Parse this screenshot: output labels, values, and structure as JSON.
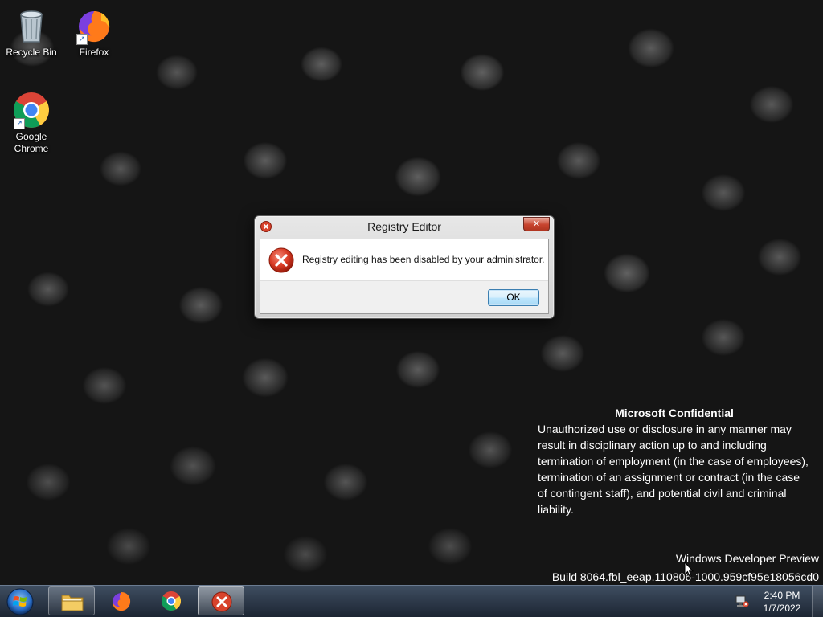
{
  "desktop": {
    "icons": [
      {
        "label": "Recycle Bin",
        "icon": "recycle-bin-icon"
      },
      {
        "label": "Firefox",
        "icon": "firefox-icon"
      },
      {
        "label": "Google Chrome",
        "icon": "chrome-icon"
      }
    ],
    "confidential": {
      "heading": "Microsoft Confidential",
      "body": "Unauthorized use or disclosure in any manner may result in disciplinary action up to and including termination of employment (in the case of employees), termination of an assignment or contract (in the case of contingent staff), and potential civil and criminal liability."
    },
    "watermark": {
      "line1": "Windows Developer Preview",
      "line2": "Build 8064.fbl_eeap.110806-1000.959cf95e18056cd0"
    }
  },
  "dialog": {
    "title": "Registry Editor",
    "message": "Registry editing has been disabled by your administrator.",
    "ok_label": "OK",
    "close_glyph": "✕",
    "icon": "error-icon"
  },
  "taskbar": {
    "start": "start-button",
    "pinned": [
      "file-explorer",
      "firefox",
      "chrome",
      "error-dialog-window"
    ],
    "clock": {
      "time": "2:40 PM",
      "date": "1/7/2022"
    },
    "accent": "#2a6fc9"
  }
}
